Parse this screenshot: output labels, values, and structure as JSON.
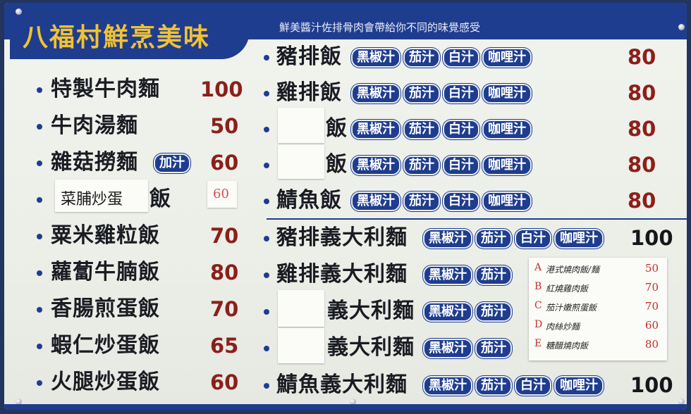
{
  "header": {
    "title": "八福村鮮烹美味",
    "subtitle": "鮮美醬汁佐排骨肉會帶給你不同的味覺感受"
  },
  "sauce_pills": [
    "黑椒汁",
    "茄汁",
    "白汁",
    "咖哩汁"
  ],
  "add_sauce_pill": "加汁",
  "left_menu": [
    {
      "name": "特製牛肉麵",
      "price": "100"
    },
    {
      "name": "牛肉湯麵",
      "price": "50"
    },
    {
      "name": "雜菇撈麵",
      "price": "60"
    },
    {
      "name_handwritten": "菜脯炒蛋",
      "name_suffix": "飯",
      "price_handwritten": "60"
    },
    {
      "name": "粟米雞粒飯",
      "price": "70"
    },
    {
      "name": "蘿蔔牛腩飯",
      "price": "80"
    },
    {
      "name": "香腸煎蛋飯",
      "price": "70"
    },
    {
      "name": "蝦仁炒蛋飯",
      "price": "65"
    },
    {
      "name": "火腿炒蛋飯",
      "price": "60"
    }
  ],
  "rice_menu": [
    {
      "name": "豬排飯",
      "price": "80"
    },
    {
      "name": "雞排飯",
      "price": "80"
    },
    {
      "name": "飯",
      "price": "80"
    },
    {
      "name": "飯",
      "price": "80"
    },
    {
      "name": "鯖魚飯",
      "price": "80"
    }
  ],
  "pasta_menu": [
    {
      "name": "豬排義大利麵",
      "price": "100"
    },
    {
      "name": "雞排義大利麵"
    },
    {
      "name": "義大利麵"
    },
    {
      "name": "義大利麵"
    },
    {
      "name": "鯖魚義大利麵",
      "price": "100"
    }
  ],
  "handwritten_note": [
    {
      "letter": "A",
      "name": "港式燒肉飯/麵",
      "price": "50"
    },
    {
      "letter": "B",
      "name": "紅燒雞肉飯",
      "price": "70"
    },
    {
      "letter": "C",
      "name": "茄汁嫩煎蛋飯",
      "price": "70"
    },
    {
      "letter": "D",
      "name": "肉絲炒麵",
      "price": "60"
    },
    {
      "letter": "E",
      "name": "糖醋燒肉飯",
      "price": "80"
    }
  ],
  "colors": {
    "board_blue": "#1f3d8f",
    "title_yellow": "#f2c230",
    "price_red": "#8c1f1a"
  }
}
